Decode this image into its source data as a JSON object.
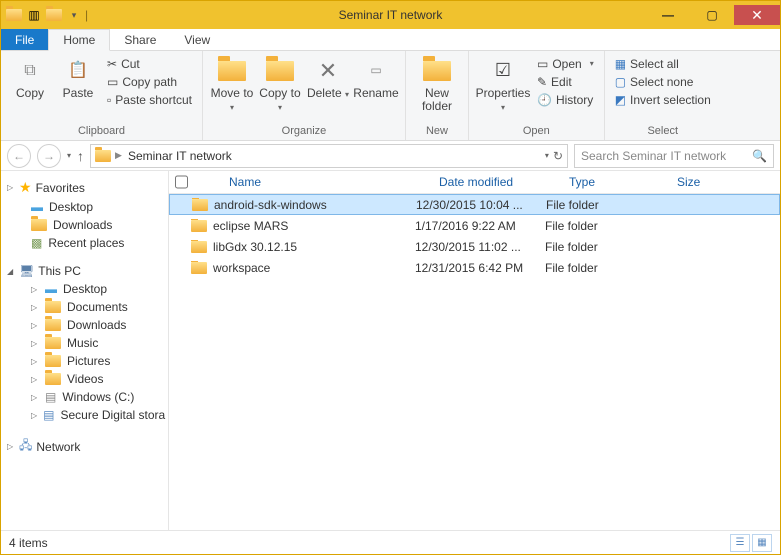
{
  "title": "Seminar IT network",
  "tabs": {
    "file": "File",
    "home": "Home",
    "share": "Share",
    "view": "View"
  },
  "ribbon": {
    "clipboard": {
      "label": "Clipboard",
      "copy": "Copy",
      "paste": "Paste",
      "cut": "Cut",
      "copy_path": "Copy path",
      "paste_shortcut": "Paste shortcut"
    },
    "organize": {
      "label": "Organize",
      "move_to": "Move to",
      "copy_to": "Copy to",
      "delete": "Delete",
      "rename": "Rename"
    },
    "new": {
      "label": "New",
      "new_folder": "New folder"
    },
    "open": {
      "label": "Open",
      "properties": "Properties",
      "open": "Open",
      "edit": "Edit",
      "history": "History"
    },
    "select": {
      "label": "Select",
      "select_all": "Select all",
      "select_none": "Select none",
      "invert": "Invert selection"
    }
  },
  "breadcrumbs": [
    "Seminar IT network"
  ],
  "search_placeholder": "Search Seminar IT network",
  "nav": {
    "favorites": {
      "label": "Favorites",
      "items": [
        "Desktop",
        "Downloads",
        "Recent places"
      ]
    },
    "thispc": {
      "label": "This PC",
      "items": [
        "Desktop",
        "Documents",
        "Downloads",
        "Music",
        "Pictures",
        "Videos",
        "Windows (C:)",
        "Secure Digital stora"
      ]
    },
    "network": {
      "label": "Network"
    }
  },
  "columns": {
    "name": "Name",
    "date": "Date modified",
    "type": "Type",
    "size": "Size"
  },
  "rows": [
    {
      "name": "android-sdk-windows",
      "date": "12/30/2015 10:04 ...",
      "type": "File folder",
      "selected": true
    },
    {
      "name": "eclipse MARS",
      "date": "1/17/2016 9:22 AM",
      "type": "File folder",
      "selected": false
    },
    {
      "name": "libGdx 30.12.15",
      "date": "12/30/2015 11:02 ...",
      "type": "File folder",
      "selected": false
    },
    {
      "name": "workspace",
      "date": "12/31/2015 6:42 PM",
      "type": "File folder",
      "selected": false
    }
  ],
  "status": "4 items"
}
